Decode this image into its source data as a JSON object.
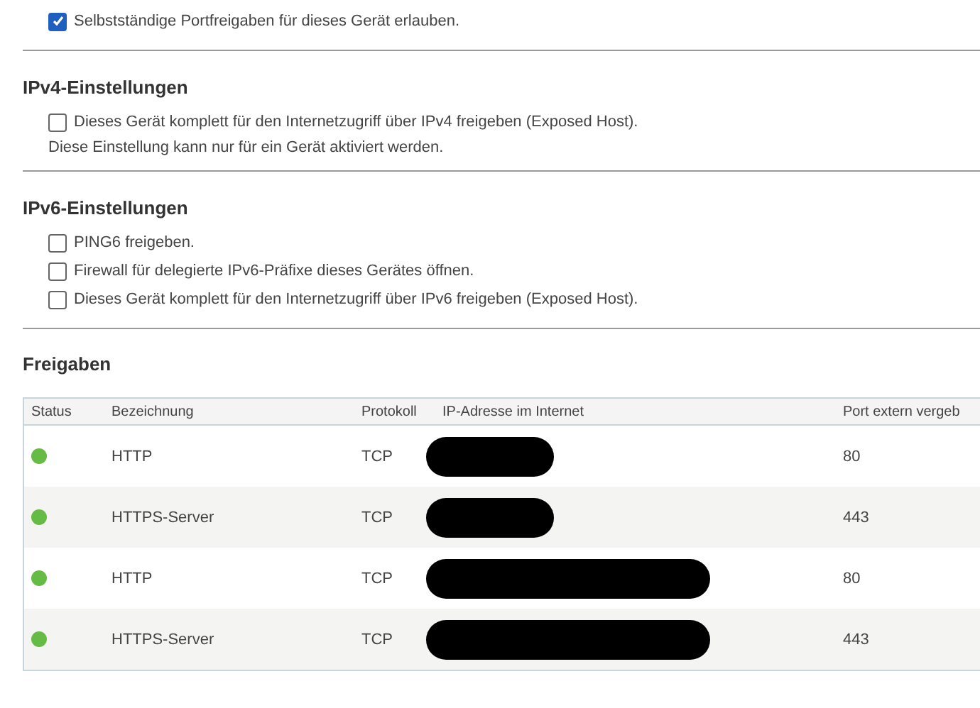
{
  "top_option": {
    "label": "Selbstständige Portfreigaben für dieses Gerät erlauben.",
    "checked": true
  },
  "sections": [
    {
      "title": "IPv4-Einstellungen",
      "options": [
        {
          "label": "Dieses Gerät komplett für den Internetzugriff über IPv4 freigeben (Exposed Host).",
          "checked": false
        }
      ],
      "note": "Diese Einstellung kann nur für ein Gerät aktiviert werden."
    },
    {
      "title": "IPv6-Einstellungen",
      "options": [
        {
          "label": "PING6 freigeben.",
          "checked": false
        },
        {
          "label": "Firewall für delegierte IPv6-Präfixe dieses Gerätes öffnen.",
          "checked": false
        },
        {
          "label": "Dieses Gerät komplett für den Internetzugriff über IPv6 freigeben (Exposed Host).",
          "checked": false
        }
      ]
    }
  ],
  "shares": {
    "title": "Freigaben",
    "table": {
      "columns": [
        "Status",
        "Bezeichnung",
        "Protokoll",
        "IP-Adresse im Internet",
        "Port extern vergeb"
      ],
      "rows": [
        {
          "color": "#66bb44",
          "name": "HTTP",
          "protocol": "TCP",
          "ip_redacted": true,
          "port": "80"
        },
        {
          "color": "#66bb44",
          "name": "HTTPS-Server",
          "protocol": "TCP",
          "ip_redacted": true,
          "port": "443"
        },
        {
          "color": "#66bb44",
          "name": "HTTP",
          "protocol": "TCP",
          "ip_redacted": true,
          "port": "80"
        },
        {
          "color": "#66bb44",
          "name": "HTTPS-Server",
          "protocol": "TCP",
          "ip_redacted": true,
          "port": "443"
        }
      ]
    }
  }
}
